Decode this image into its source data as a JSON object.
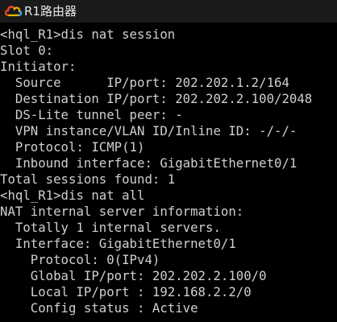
{
  "window": {
    "title": "R1路由器",
    "icon": "cloud-icon",
    "icon_colors": [
      "#e8412a",
      "#f6b400",
      "#2aa6ff"
    ]
  },
  "terminal": {
    "text_color": "#cfcfcf",
    "background": "#000000",
    "lines": [
      "<hql_R1>dis nat session",
      "Slot 0:",
      "Initiator:",
      "  Source      IP/port: 202.202.1.2/164",
      "  Destination IP/port: 202.202.2.100/2048",
      "  DS-Lite tunnel peer: -",
      "  VPN instance/VLAN ID/Inline ID: -/-/-",
      "  Protocol: ICMP(1)",
      "  Inbound interface: GigabitEthernet0/1",
      "Total sessions found: 1",
      "<hql_R1>dis nat all",
      "NAT internal server information:",
      "  Totally 1 internal servers.",
      "  Interface: GigabitEthernet0/1",
      "    Protocol: 0(IPv4)",
      "    Global IP/port: 202.202.2.100/0",
      "    Local IP/port : 192.168.2.2/0",
      "    Config status : Active"
    ]
  }
}
